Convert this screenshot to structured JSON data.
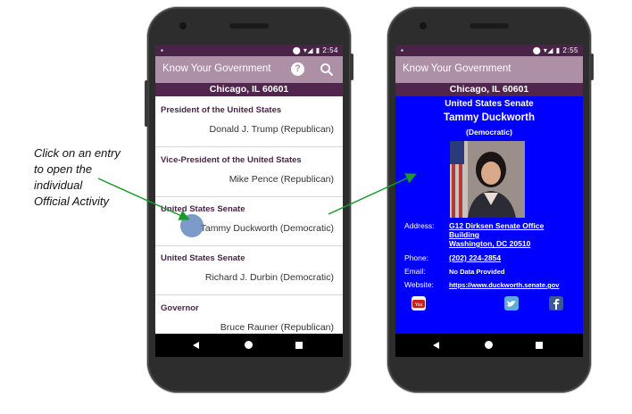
{
  "caption": {
    "lines": [
      "Click on an entry",
      "to open the",
      "individual",
      "Official Activity"
    ]
  },
  "list_phone": {
    "status_time": "2:54",
    "app_title": "Know Your Government",
    "location": "Chicago, IL 60601",
    "entries": [
      {
        "office": "President of the United States",
        "official": "Donald J. Trump (Republican)"
      },
      {
        "office": "Vice-President of the United States",
        "official": "Mike Pence (Republican)"
      },
      {
        "office": "United States Senate",
        "official": "Tammy Duckworth (Democratic)"
      },
      {
        "office": "United States Senate",
        "official": "Richard J. Durbin (Democratic)"
      },
      {
        "office": "Governor",
        "official": "Bruce Rauner (Republican)"
      }
    ]
  },
  "detail_phone": {
    "status_time": "2:55",
    "app_title": "Know Your Government",
    "location": "Chicago, IL 60601",
    "office": "United States Senate",
    "name": "Tammy Duckworth",
    "party": "(Democratic)",
    "address_label": "Address:",
    "address_lines": [
      "G12 Dirksen Senate Office",
      "Building",
      "Washington, DC 20510"
    ],
    "phone_label": "Phone:",
    "phone": "(202) 224-2854",
    "email_label": "Email:",
    "email": "No Data Provided",
    "website_label": "Website:",
    "website": "https://www.duckworth.senate.gov",
    "colors": {
      "background": "#0000ff",
      "appbar": "#ad8fa6",
      "location_bar": "#52254e"
    }
  },
  "icons": [
    "help-icon",
    "search-icon",
    "youtube-icon",
    "twitter-icon",
    "facebook-icon",
    "back-icon",
    "home-icon",
    "recents-icon"
  ]
}
